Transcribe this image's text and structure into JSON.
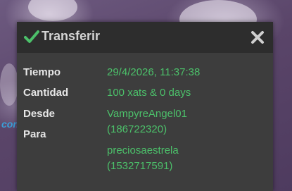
{
  "dialog": {
    "title": "Transferir",
    "title_icon": "check-icon",
    "close_icon": "close-icon"
  },
  "background": {
    "link_fragment": "con"
  },
  "fields": {
    "time_label": "Tiempo",
    "time_value": "29/4/2026, 11:37:38",
    "amount_label": "Cantidad",
    "amount_value": "100 xats & 0 days",
    "from_label": "Desde",
    "from_name": "VampyreAngel01",
    "from_id": "(186722320)",
    "to_label": "Para",
    "to_name": "preciosaestrela",
    "to_id": "(1532717591)"
  },
  "colors": {
    "accent_green": "#4cc06a",
    "header_bg": "#2d2d2d",
    "dialog_bg": "#3d3d3d"
  }
}
